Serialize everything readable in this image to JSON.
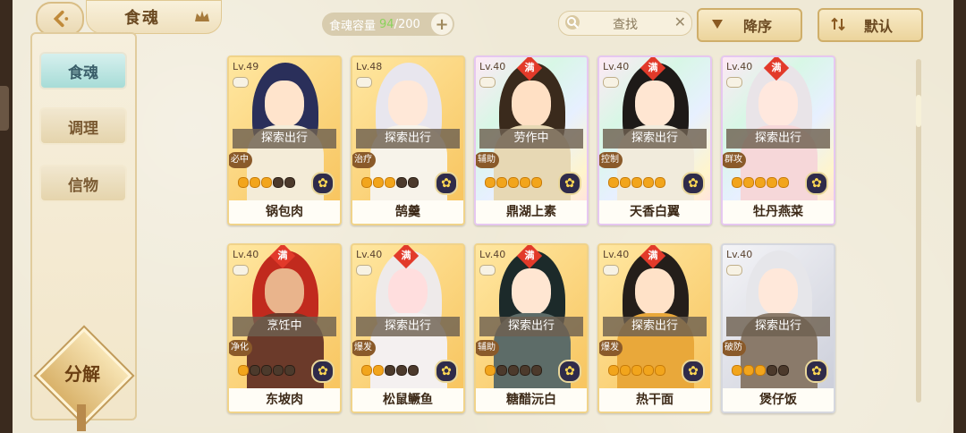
{
  "header": {
    "title": "食魂",
    "capacity_label": "食魂容量",
    "capacity_current": "94",
    "capacity_max": "/200",
    "add_symbol": "+",
    "search_placeholder": "查找",
    "clear_symbol": "✕",
    "sort_order_label": "降序",
    "sort_mode_label": "默认"
  },
  "sidebar": {
    "items": [
      {
        "label": "食魂",
        "active": true
      },
      {
        "label": "调理",
        "active": false
      },
      {
        "label": "信物",
        "active": false
      }
    ],
    "decompose_label": "分解"
  },
  "cards": [
    {
      "level": "Lv.49",
      "maxed": false,
      "status": "探索出行",
      "role": "必中",
      "stars": 3,
      "name": "锅包肉",
      "frame": "gold",
      "hair": "#2a2f5a",
      "face": "#ffe4cc",
      "outfit": "#f4ecd8"
    },
    {
      "level": "Lv.48",
      "maxed": false,
      "status": "探索出行",
      "role": "治疗",
      "stars": 3,
      "name": "鹄羹",
      "frame": "gold",
      "hair": "#e8e6ee",
      "face": "#ffe8d8",
      "outfit": "#f7f3ea"
    },
    {
      "level": "Lv.40",
      "maxed": true,
      "status": "劳作中",
      "role": "辅助",
      "stars": 5,
      "name": "鼎湖上素",
      "frame": "rainbow",
      "hair": "#3a2a1c",
      "face": "#ffe0c4",
      "outfit": "#e7d8b4"
    },
    {
      "level": "Lv.40",
      "maxed": true,
      "status": "探索出行",
      "role": "控制",
      "stars": 5,
      "name": "天香白翼",
      "frame": "rainbow",
      "hair": "#1e1a18",
      "face": "#ffe6d2",
      "outfit": "#f1ebdc"
    },
    {
      "level": "Lv.40",
      "maxed": true,
      "status": "探索出行",
      "role": "群攻",
      "stars": 5,
      "name": "牡丹燕菜",
      "frame": "rainbow",
      "hair": "#e9e4e8",
      "face": "#ffe8de",
      "outfit": "#f6d7d9"
    },
    {
      "level": "Lv.40",
      "maxed": true,
      "status": "烹饪中",
      "role": "净化",
      "stars": 1,
      "name": "东坡肉",
      "frame": "gold",
      "hair": "#c12a1e",
      "face": "#e9b48c",
      "outfit": "#6b3a2a"
    },
    {
      "level": "Lv.40",
      "maxed": true,
      "status": "探索出行",
      "role": "爆发",
      "stars": 2,
      "name": "松鼠鳜鱼",
      "frame": "gold",
      "hair": "#eeeaea",
      "face": "#ffdede",
      "outfit": "#f4f0f0"
    },
    {
      "level": "Lv.40",
      "maxed": true,
      "status": "探索出行",
      "role": "辅助",
      "stars": 1,
      "name": "糖醋沅白",
      "frame": "gold",
      "hair": "#1c2a2a",
      "face": "#ffe6d2",
      "outfit": "#5d6c68"
    },
    {
      "level": "Lv.40",
      "maxed": true,
      "status": "探索出行",
      "role": "爆发",
      "stars": 5,
      "name": "热干面",
      "frame": "gold",
      "hair": "#241e1a",
      "face": "#ffe2c8",
      "outfit": "#e9a83a"
    },
    {
      "level": "Lv.40",
      "maxed": false,
      "status": "探索出行",
      "role": "破防",
      "stars": 3,
      "name": "煲仔饭",
      "frame": "silver",
      "hair": "#e6e6ea",
      "face": "#ffe8da",
      "outfit": "#8a7a6a"
    }
  ]
}
